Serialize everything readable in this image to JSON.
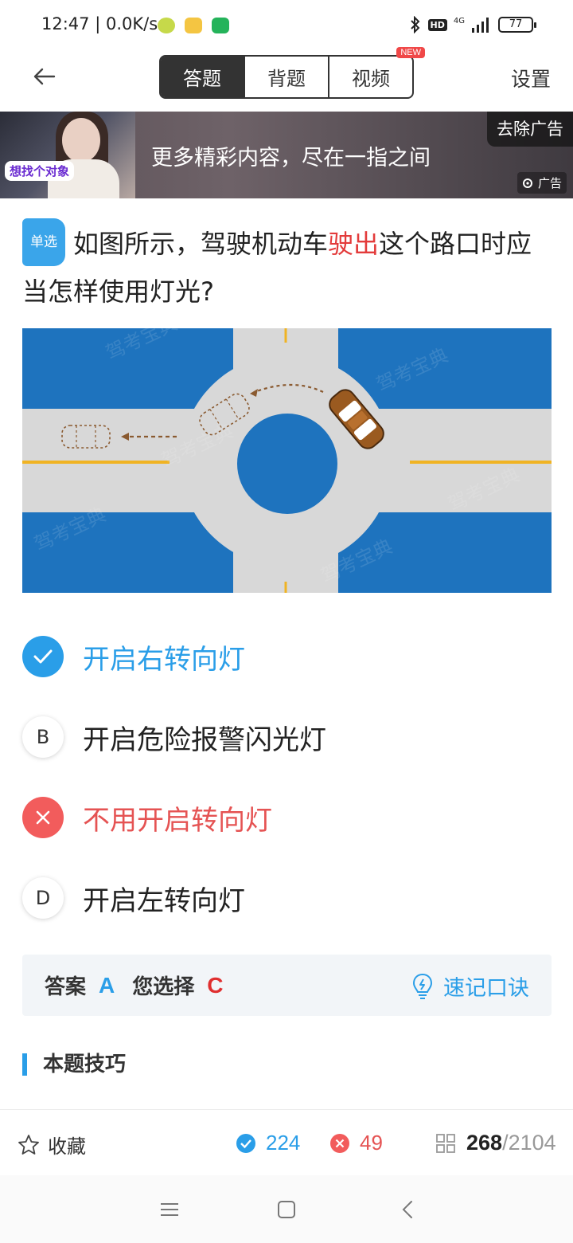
{
  "status_bar": {
    "time": "12:47",
    "net_speed": "0.0K/s",
    "hd": "HD",
    "network": "4G",
    "battery": "77"
  },
  "nav": {
    "tabs": [
      {
        "label": "答题",
        "active": true
      },
      {
        "label": "背题",
        "active": false
      },
      {
        "label": "视频",
        "active": false,
        "badge": "NEW"
      }
    ],
    "settings_label": "设置"
  },
  "ad": {
    "image_tag": "想找个对象",
    "text": "更多精彩内容，尽在一指之间",
    "remove_label": "去除广告",
    "ad_label": "广告"
  },
  "question": {
    "type_label": "单选",
    "text_before": "如图所示，驾驶机动车",
    "text_highlight": "驶出",
    "text_after": "这个路口时应当怎样使用灯光?"
  },
  "figure": {
    "watermark": "驾考宝典"
  },
  "options": [
    {
      "key": "A",
      "text": "开启右转向灯",
      "state": "correct"
    },
    {
      "key": "B",
      "text": "开启危险报警闪光灯",
      "state": "normal"
    },
    {
      "key": "C",
      "text": "不用开启转向灯",
      "state": "wrong"
    },
    {
      "key": "D",
      "text": "开启左转向灯",
      "state": "normal"
    }
  ],
  "answer_bar": {
    "answer_label": "答案",
    "answer_value": "A",
    "choice_label": "您选择",
    "choice_value": "C",
    "mnemonic_label": "速记口诀"
  },
  "tips": {
    "title": "本题技巧"
  },
  "toolbar": {
    "favorite_label": "收藏",
    "correct_count": "224",
    "wrong_count": "49",
    "current": "268",
    "total": "/2104"
  },
  "colors": {
    "accent": "#2a9ee8",
    "error": "#e55353",
    "road_blue": "#1e73be",
    "road_gray": "#d8d8d8",
    "lane_yellow": "#f0b323"
  }
}
